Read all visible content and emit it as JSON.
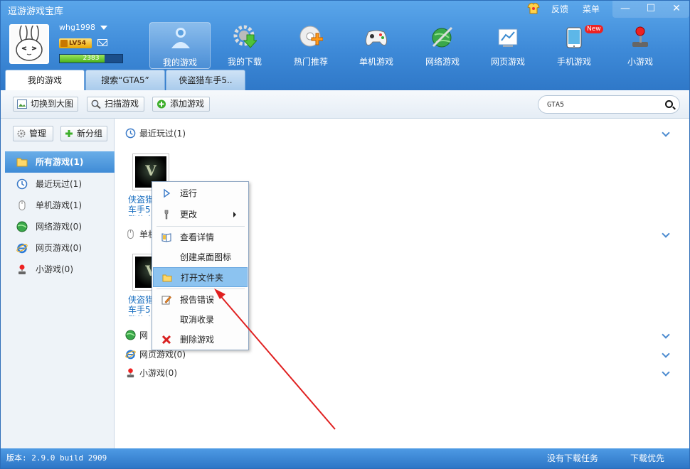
{
  "app": {
    "title": "逗游游戏宝库",
    "skin_label": "反馈",
    "menu_label": "菜单"
  },
  "window_controls": {
    "minimize": "—",
    "maximize": "☐",
    "close": "✕"
  },
  "user": {
    "name": "whg1998",
    "level": "LV54",
    "exp_value": "2383",
    "exp_fraction": 0.72
  },
  "nav": [
    {
      "label": "我的游戏",
      "icon": "person-icon"
    },
    {
      "label": "我的下载",
      "icon": "download-gear-icon"
    },
    {
      "label": "热门推荐",
      "icon": "disc-icon"
    },
    {
      "label": "单机游戏",
      "icon": "gamepad-icon"
    },
    {
      "label": "网络游戏",
      "icon": "globe-sword-icon"
    },
    {
      "label": "网页游戏",
      "icon": "web-chart-icon"
    },
    {
      "label": "手机游戏",
      "icon": "phone-icon",
      "badge": "New"
    },
    {
      "label": "小游戏",
      "icon": "joystick-icon"
    }
  ],
  "tabs": [
    {
      "label": "我的游戏"
    },
    {
      "label": "搜索“GTA5”"
    },
    {
      "label": "侠盗猎车手5.."
    }
  ],
  "toolbar": {
    "switch_big": "切换到大图",
    "scan": "扫描游戏",
    "add": "添加游戏"
  },
  "search": {
    "value": "GTA5"
  },
  "sidebar": {
    "manage": "管理",
    "new_group": "新分组",
    "items": [
      {
        "label": "所有游戏(1)",
        "icon": "folder-icon"
      },
      {
        "label": "最近玩过(1)",
        "icon": "clock-icon"
      },
      {
        "label": "单机游戏(1)",
        "icon": "mouse-icon"
      },
      {
        "label": "网络游戏(0)",
        "icon": "globe-icon"
      },
      {
        "label": "网页游戏(0)",
        "icon": "ie-icon"
      },
      {
        "label": "小游戏(0)",
        "icon": "joystick-icon"
      }
    ]
  },
  "sections": {
    "recent": "最近玩过(1)",
    "single": "单机",
    "online": "网",
    "web": "网页游戏(0)",
    "mini": "小游戏(0)"
  },
  "game": {
    "name": "侠盗猎车手5繁体中文",
    "name_visible": "侠盗猎\n繁体中",
    "thumb_text": "V"
  },
  "context_menu": {
    "run": "运行",
    "change": "更改",
    "details": "查看详情",
    "desktop_icon": "创建桌面图标",
    "open_folder": "打开文件夹",
    "report": "报告错误",
    "unfavorite": "取消收录",
    "delete": "删除游戏"
  },
  "status": {
    "version": "版本: 2.9.0 build 2909",
    "no_task": "没有下载任务",
    "priority": "下载优先"
  }
}
